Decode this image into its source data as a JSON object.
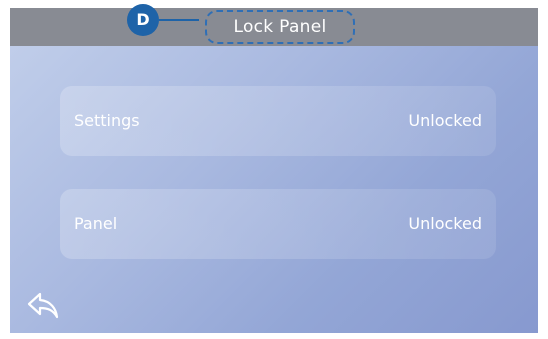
{
  "header": {
    "badge_letter": "D",
    "title": "Lock Panel"
  },
  "rows": [
    {
      "label": "Settings",
      "status": "Unlocked"
    },
    {
      "label": "Panel",
      "status": "Unlocked"
    }
  ],
  "icons": {
    "back": "back-arrow-icon"
  },
  "colors": {
    "title_bar": "#888b93",
    "badge": "#1e63a8",
    "callout_outline": "#2f6fb6"
  }
}
